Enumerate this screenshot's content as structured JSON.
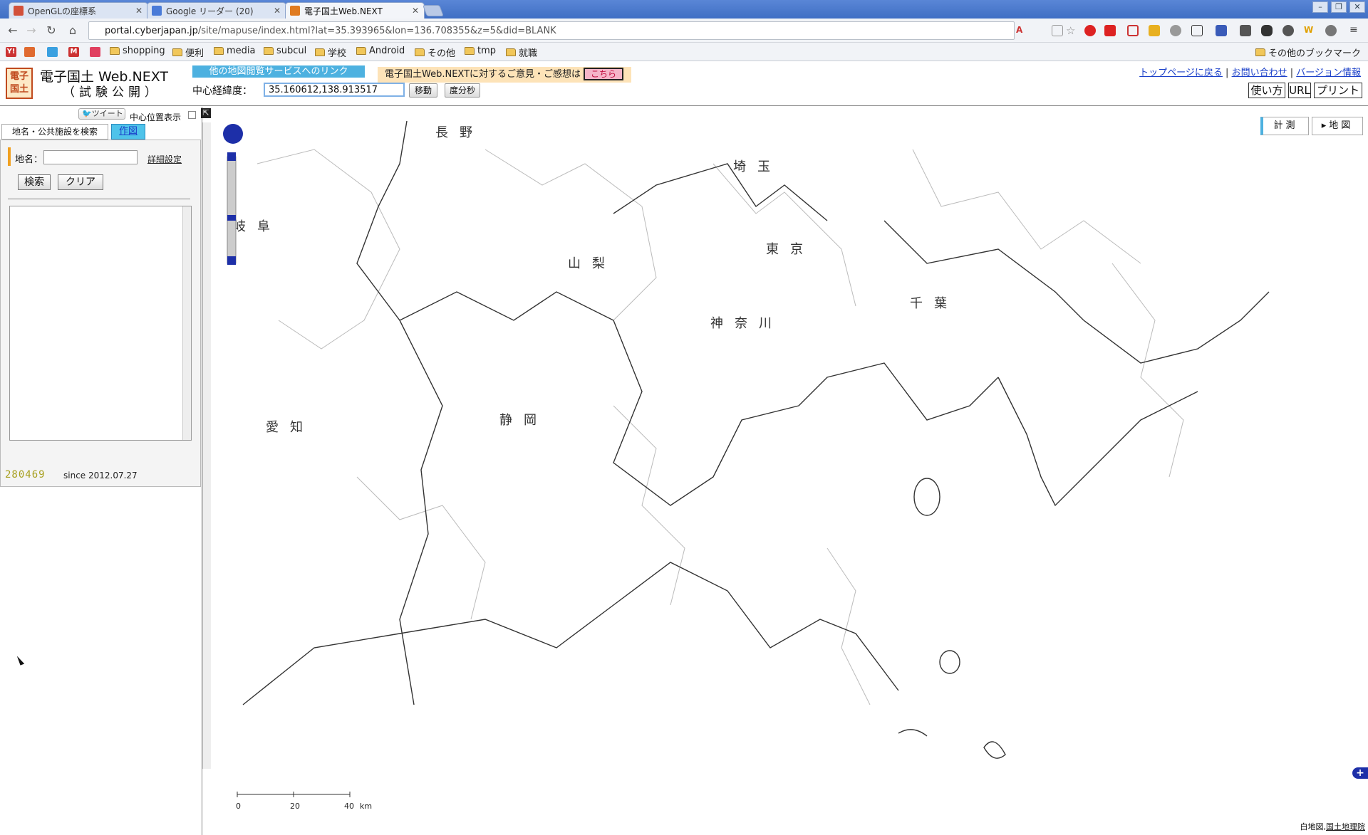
{
  "browser": {
    "tabs": [
      {
        "title": "OpenGLの座標系",
        "active": false,
        "favicon_color": "#d2503a"
      },
      {
        "title": "Google リーダー (20)",
        "active": false,
        "favicon_color": "#4a7bd8"
      },
      {
        "title": "電子国土Web.NEXT",
        "active": true,
        "favicon_color": "#e07b20"
      }
    ],
    "url_host": "portal.cyberjapan.jp",
    "url_path": "/site/mapuse/index.html?lat=35.393965&lon=136.708355&z=5&did=BLANK",
    "bookmarks": [
      {
        "label": "shopping",
        "type": "folder"
      },
      {
        "label": "便利",
        "type": "folder"
      },
      {
        "label": "media",
        "type": "folder"
      },
      {
        "label": "subcul",
        "type": "folder"
      },
      {
        "label": "学校",
        "type": "folder"
      },
      {
        "label": "Android",
        "type": "folder"
      },
      {
        "label": "その他",
        "type": "folder"
      },
      {
        "label": "tmp",
        "type": "folder"
      },
      {
        "label": "就職",
        "type": "folder"
      }
    ],
    "other_bookmarks": "その他のブックマーク"
  },
  "header": {
    "logo_chars": "電子国土",
    "title": "電子国土 Web.NEXT",
    "subtitle": "（試験公開）",
    "other_services_link": "他の地図閲覧サービスへのリンク",
    "opinion_text": "電子国土Web.NEXTに対するご意見・ご感想は",
    "opinion_link": "こちら",
    "coord_label": "中心経緯度：",
    "coord_value": "35.160612,138.913517",
    "move_button": "移動",
    "dms_button": "度分秒",
    "links": [
      "トップページに戻る",
      "お問い合わせ",
      "バージョン情報"
    ],
    "help_button": "使い方",
    "url_button": "URL",
    "print_button": "プリント"
  },
  "panel": {
    "tweet": "ツイート",
    "center_display_label": "中心位置表示",
    "tab_search": "地名・公共施設を検索",
    "tab_draw": "作図",
    "placename_label": "地名：",
    "placename_value": "",
    "detail_link": "詳細設定",
    "search_button": "検索",
    "clear_button": "クリア",
    "counter": "280469",
    "since": "since 2012.07.27"
  },
  "map": {
    "prefectures": [
      "長野",
      "埼玉",
      "岐阜",
      "山梨",
      "東京",
      "千葉",
      "神奈川",
      "愛知",
      "静岡"
    ],
    "measure_button": "計測",
    "map_button": "地図",
    "scale_labels": [
      "0",
      "20",
      "40",
      "km"
    ],
    "credit_prefix": "白地図,",
    "credit_link": "国土地理院"
  }
}
